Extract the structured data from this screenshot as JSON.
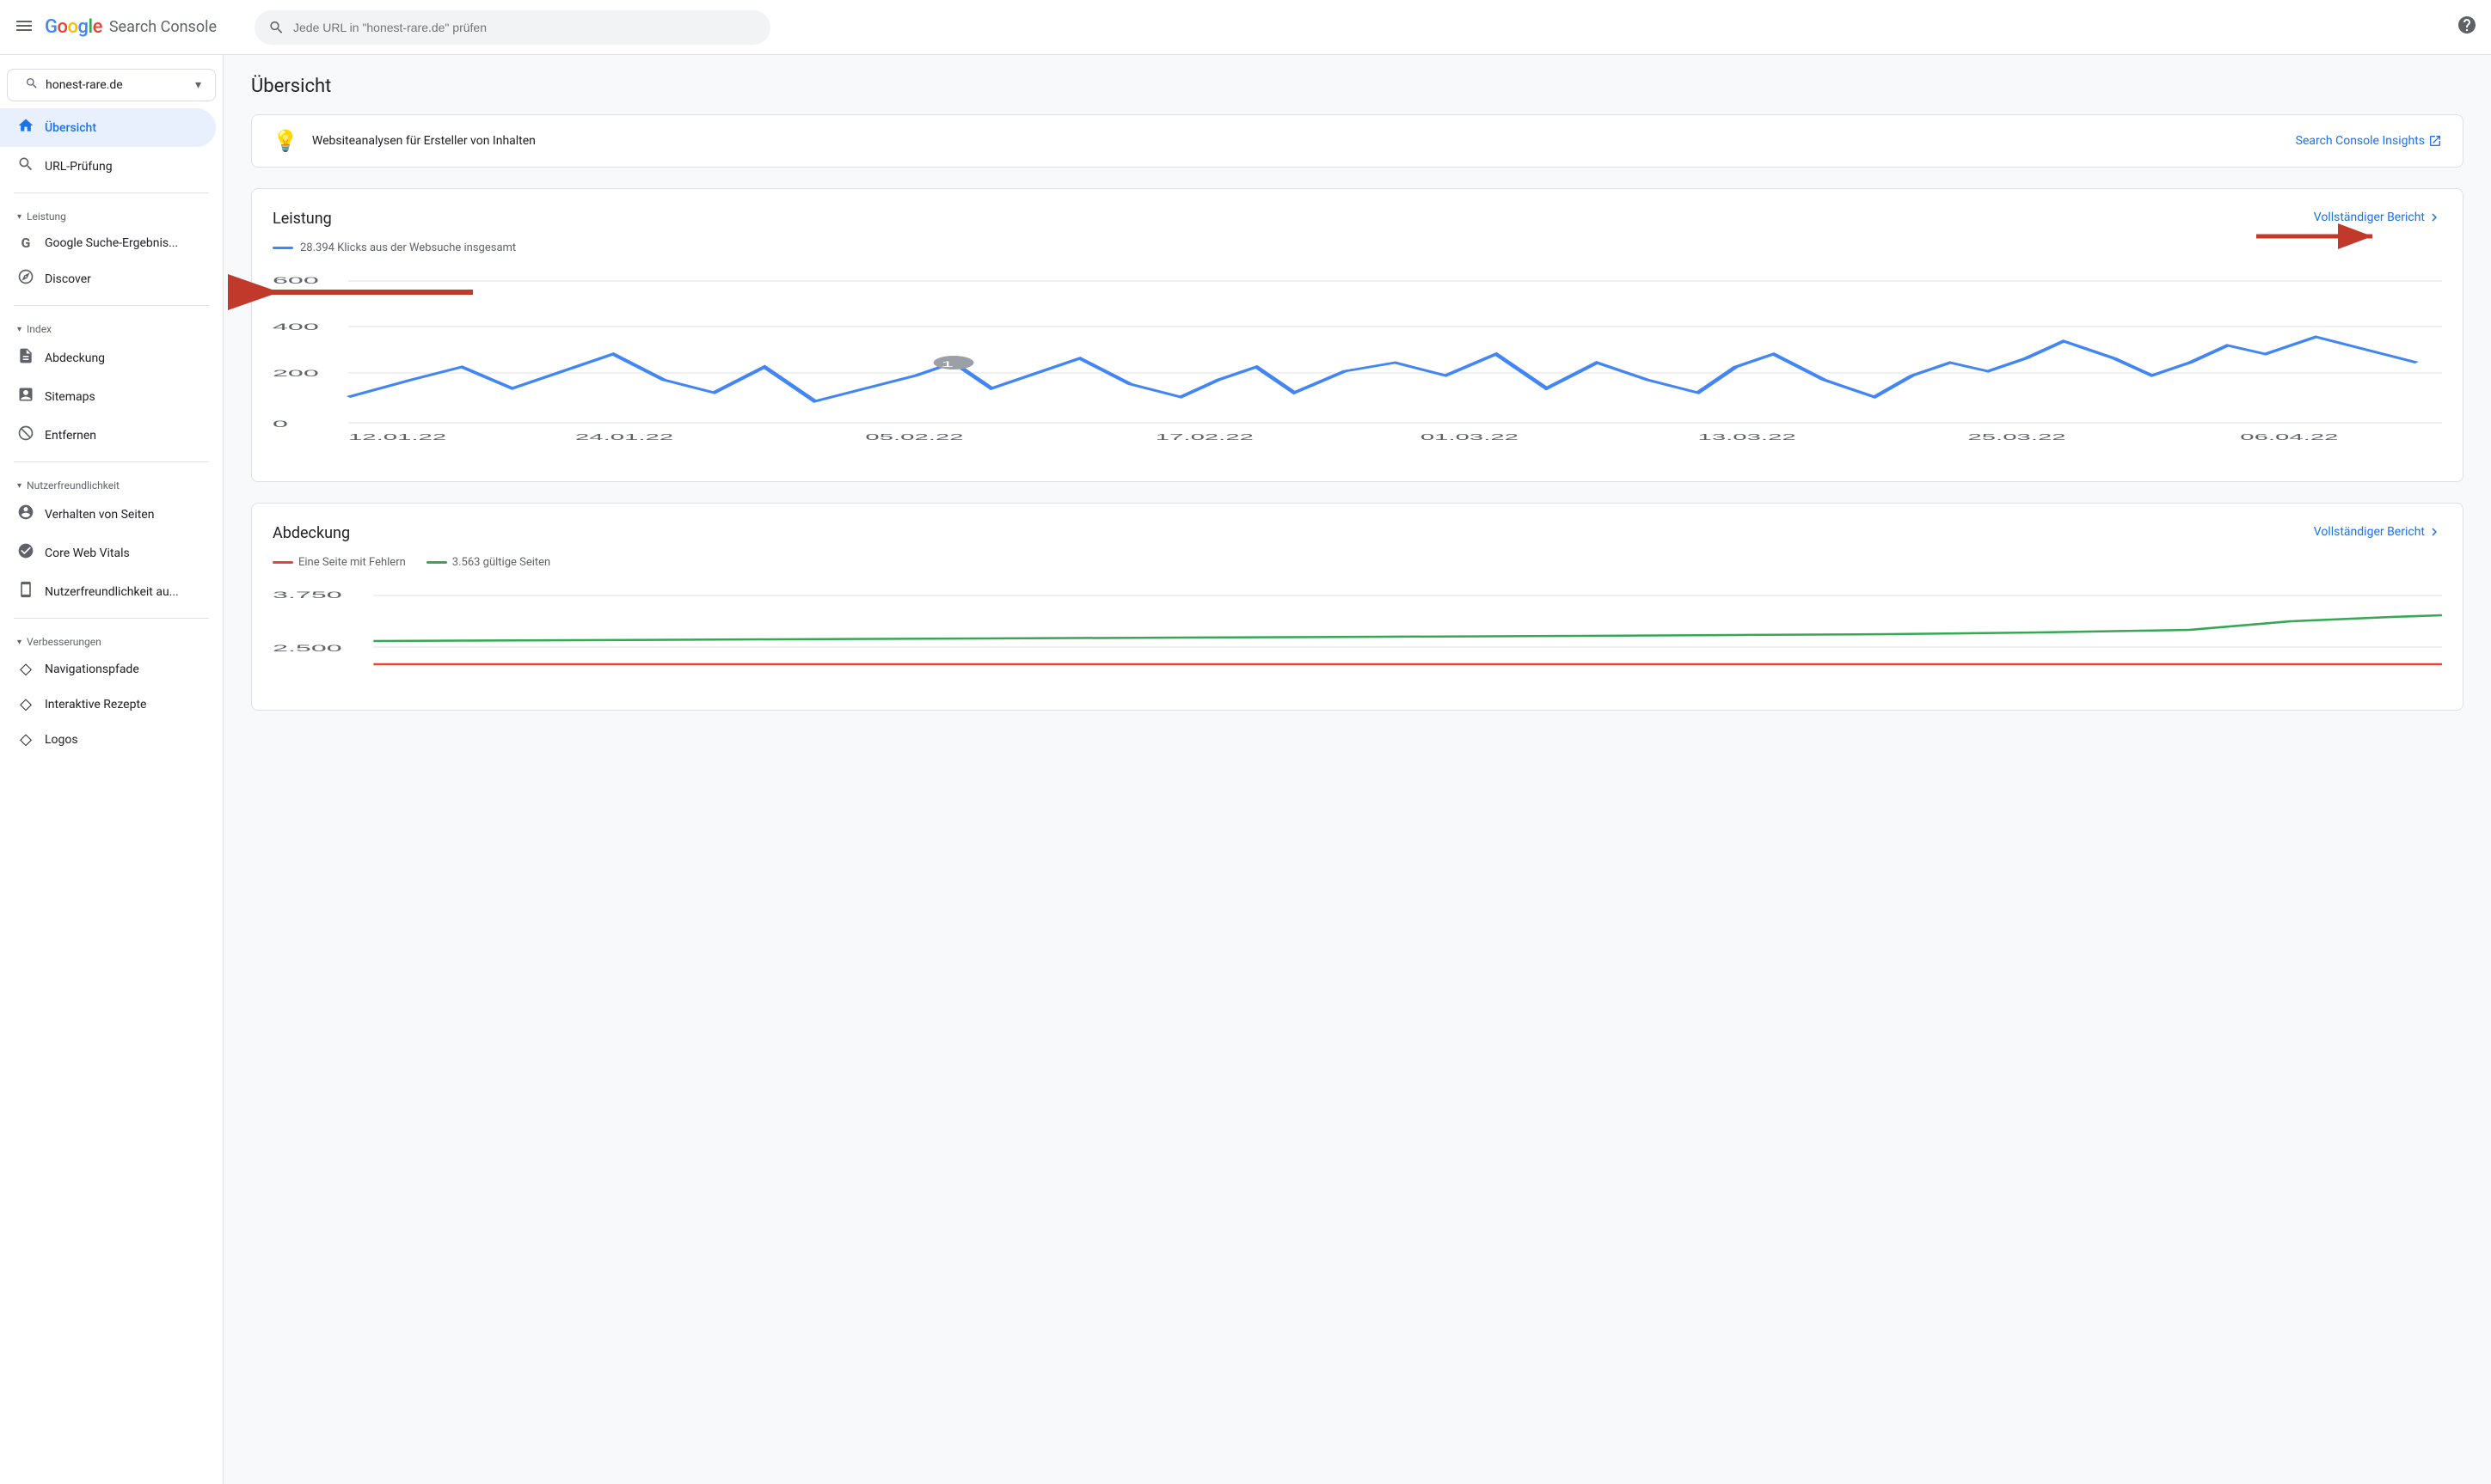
{
  "header": {
    "menu_icon": "☰",
    "logo_letters": [
      {
        "letter": "G",
        "color": "g-blue"
      },
      {
        "letter": "o",
        "color": "g-red"
      },
      {
        "letter": "o",
        "color": "g-yellow"
      },
      {
        "letter": "g",
        "color": "g-blue"
      },
      {
        "letter": "l",
        "color": "g-green"
      },
      {
        "letter": "e",
        "color": "g-red"
      }
    ],
    "app_name": "Search Console",
    "search_placeholder": "Jede URL in \"honest-rare.de\" prüfen",
    "help_icon": "?"
  },
  "sidebar": {
    "property": {
      "name": "honest-rare.de",
      "icon": "🔍"
    },
    "items": [
      {
        "id": "uebersicht",
        "label": "Übersicht",
        "icon": "🏠",
        "active": true,
        "section": null
      },
      {
        "id": "url-pruefung",
        "label": "URL-Prüfung",
        "icon": "🔍",
        "active": false,
        "section": null
      },
      {
        "id": "leistung-section",
        "label": "Leistung",
        "section_label": true
      },
      {
        "id": "google-suche",
        "label": "Google Suche-Ergebnis...",
        "icon": "G",
        "active": false,
        "section": "leistung"
      },
      {
        "id": "discover",
        "label": "Discover",
        "icon": "✳",
        "active": false,
        "section": "leistung"
      },
      {
        "id": "index-section",
        "label": "Index",
        "section_label": true
      },
      {
        "id": "abdeckung",
        "label": "Abdeckung",
        "icon": "📄",
        "active": false,
        "section": "index"
      },
      {
        "id": "sitemaps",
        "label": "Sitemaps",
        "icon": "⊞",
        "active": false,
        "section": "index"
      },
      {
        "id": "entfernen",
        "label": "Entfernen",
        "icon": "🚫",
        "active": false,
        "section": "index"
      },
      {
        "id": "nutzerfreundlichkeit-section",
        "label": "Nutzerfreundlichkeit",
        "section_label": true
      },
      {
        "id": "verhalten",
        "label": "Verhalten von Seiten",
        "icon": "⊙",
        "active": false,
        "section": "nutzerfreundlichkeit"
      },
      {
        "id": "core-web-vitals",
        "label": "Core Web Vitals",
        "icon": "⟳",
        "active": false,
        "section": "nutzerfreundlichkeit"
      },
      {
        "id": "nutzerfreundlichkeit-au",
        "label": "Nutzerfreundlichkeit au...",
        "icon": "📱",
        "active": false,
        "section": "nutzerfreundlichkeit"
      },
      {
        "id": "verbesserungen-section",
        "label": "Verbesserungen",
        "section_label": true
      },
      {
        "id": "navigationspfade",
        "label": "Navigationspfade",
        "icon": "◇",
        "active": false,
        "section": "verbesserungen"
      },
      {
        "id": "interaktive-rezepte",
        "label": "Interaktive Rezepte",
        "icon": "◇",
        "active": false,
        "section": "verbesserungen"
      },
      {
        "id": "logos",
        "label": "Logos",
        "icon": "◇",
        "active": false,
        "section": "verbesserungen"
      }
    ]
  },
  "main": {
    "page_title": "Übersicht",
    "insights_banner": {
      "icon": "💡",
      "text": "Websiteanalysen für Ersteller von Inhalten",
      "link_text": "Search Console Insights",
      "link_icon": "↗"
    },
    "leistung_card": {
      "title": "Leistung",
      "full_report_label": "Vollständiger Bericht",
      "chevron": "›",
      "legend_color": "#4285F4",
      "legend_text": "28.394 Klicks aus der Websuche insgesamt",
      "x_labels": [
        "12.01.22",
        "24.01.22",
        "05.02.22",
        "17.02.22",
        "01.03.22",
        "13.03.22",
        "25.03.22",
        "06.04.22"
      ],
      "y_labels": [
        "600",
        "400",
        "200",
        "0"
      ],
      "tooltip_value": "1",
      "chart_color": "#4285F4"
    },
    "abdeckung_card": {
      "title": "Abdeckung",
      "full_report_label": "Vollständiger Bericht",
      "chevron": "›",
      "legend_items": [
        {
          "color": "#EA4335",
          "label": "Eine Seite mit Fehlern"
        },
        {
          "color": "#34A853",
          "label": "3.563 gültige Seiten"
        }
      ],
      "y_labels": [
        "3.750",
        "2.500"
      ]
    }
  },
  "arrows": {
    "left_arrow_label": "Google Suche-Ergebnis...",
    "right_arrow_label": "Vollständiger Bericht"
  }
}
